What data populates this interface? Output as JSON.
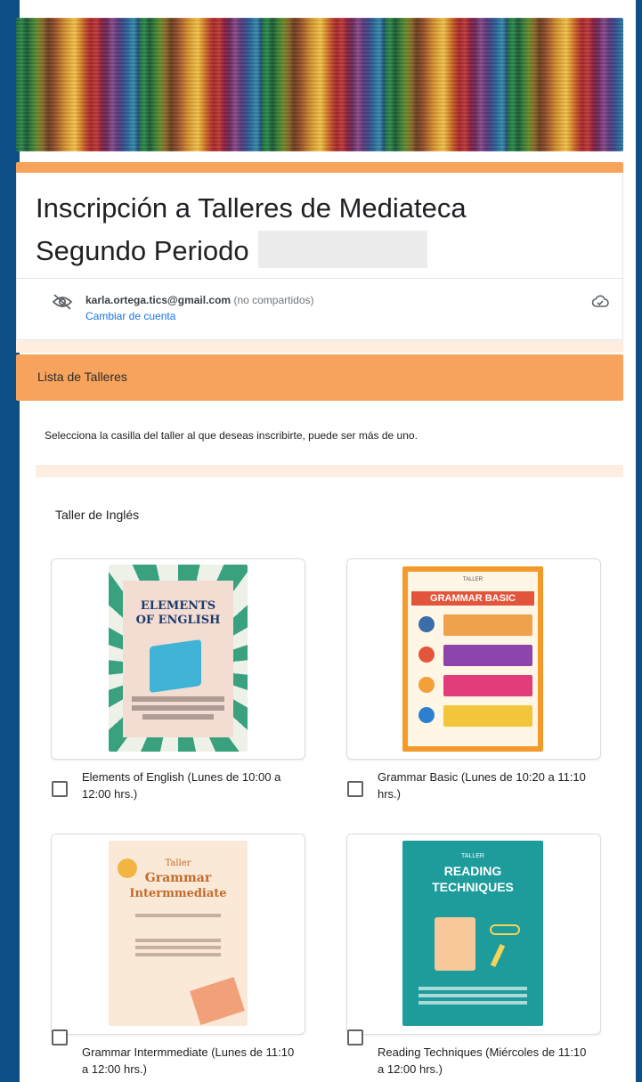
{
  "form": {
    "title_line1": "Inscripción a Talleres de Mediateca",
    "title_line2": "Segundo Periodo",
    "account_email": "karla.ortega.tics@gmail.com",
    "account_note": "(no compartidos)",
    "switch_account": "Cambiar de cuenta"
  },
  "section": {
    "title": "Lista de Talleres",
    "description": "Selecciona la casilla del taller al que deseas inscribirte, puede ser más de uno."
  },
  "question": {
    "title": "Taller de Inglés",
    "options": [
      {
        "label": "Elements of English (Lunes de 10:00 a 12:00 hrs.)",
        "checked": false,
        "poster": {
          "line1": "ELEMENTS",
          "line2": "OF ENGLISH"
        }
      },
      {
        "label": "Grammar Basic (Lunes de 10:20 a 11:10 hrs.)",
        "checked": false,
        "poster": {
          "tag": "TALLER",
          "title": "GRAMMAR BASIC"
        }
      },
      {
        "label": "Grammar Intermmediate (Lunes de 11:10 a 12:00 hrs.)",
        "checked": false,
        "poster": {
          "tag": "Taller",
          "line1": "Grammar",
          "line2": "Intermmediate"
        }
      },
      {
        "label": "Reading Techniques (Miércoles de 11:10 a 12:00 hrs.)",
        "checked": false,
        "poster": {
          "tag": "TALLER",
          "line1": "READING",
          "line2": "TECHNIQUES"
        }
      }
    ]
  },
  "colors": {
    "accent": "#f7a35c",
    "accent_light": "#fdeee1",
    "link": "#1a73e8",
    "frame": "#0b4a7e"
  },
  "icons": {
    "visibility": "eye-off-icon",
    "cloud": "cloud-check-icon"
  }
}
